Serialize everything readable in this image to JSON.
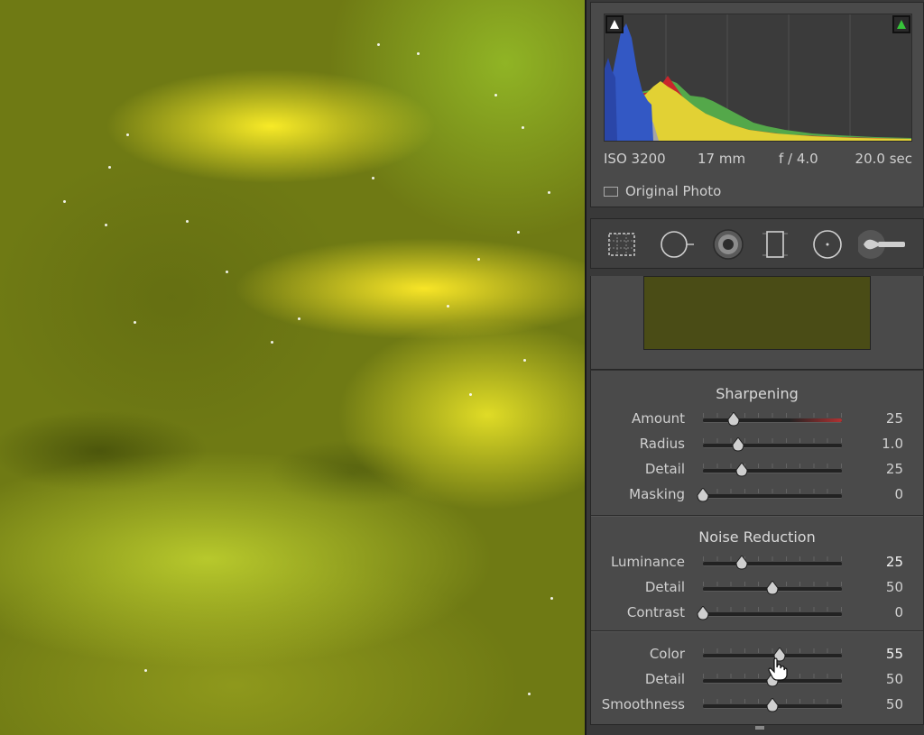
{
  "histogram": {
    "iso": "ISO 3200",
    "focal_length": "17 mm",
    "aperture": "f / 4.0",
    "shutter": "20.0 sec",
    "original_photo_label": "Original Photo",
    "clipping_colors": {
      "shadow": "#ffffff",
      "highlight": "#37c43a"
    }
  },
  "tools": [
    "crop-overlay",
    "spot-removal",
    "red-eye",
    "graduated-filter",
    "radial-filter",
    "adjustment-brush"
  ],
  "sharpening": {
    "title": "Sharpening",
    "sliders": [
      {
        "label": "Amount",
        "value": "25",
        "position": 0.22
      },
      {
        "label": "Radius",
        "value": "1.0",
        "position": 0.25
      },
      {
        "label": "Detail",
        "value": "25",
        "position": 0.28
      },
      {
        "label": "Masking",
        "value": "0",
        "position": 0.0
      }
    ]
  },
  "noise_reduction": {
    "title": "Noise Reduction",
    "sliders": [
      {
        "label": "Luminance",
        "value": "25",
        "position": 0.28,
        "bright": true
      },
      {
        "label": "Detail",
        "value": "50",
        "position": 0.5
      },
      {
        "label": "Contrast",
        "value": "0",
        "position": 0.0
      },
      {
        "label": "Color",
        "value": "55",
        "position": 0.55,
        "bright": true
      },
      {
        "label": "Detail",
        "value": "50",
        "position": 0.5
      },
      {
        "label": "Smoothness",
        "value": "50",
        "position": 0.5
      }
    ]
  },
  "colors": {
    "panel_bg": "#393939",
    "section_bg": "#4a4a4a",
    "aurora_yellow": "#f5e626",
    "aurora_green": "#9cbe2a"
  }
}
